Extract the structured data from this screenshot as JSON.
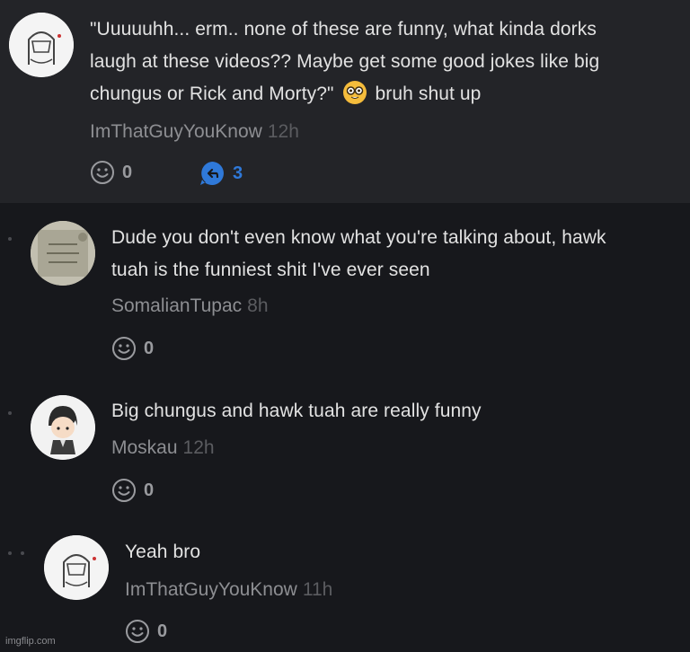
{
  "comments": [
    {
      "text_lines": [
        "\"Uuuuuhh... erm.. none of these are funny, what kinda dorks",
        "laugh at these videos?? Maybe get some good jokes like big"
      ],
      "text_line3_before": "chungus or Rick and Morty?\"",
      "text_line3_after": "bruh shut up",
      "emoji": "nerd-face-emoji",
      "username": "ImThatGuyYouKnow",
      "time": "12h",
      "likes": "0",
      "replies": "3"
    },
    {
      "text_lines": [
        "Dude you don't even know what you're talking about, hawk",
        "tuah is the funniest shit I've ever seen"
      ],
      "username": "SomalianTupac",
      "time": "8h",
      "likes": "0"
    },
    {
      "text_lines": [
        "Big chungus and hawk tuah are really funny"
      ],
      "username": "Moskau",
      "time": "12h",
      "likes": "0"
    },
    {
      "text_lines": [
        "Yeah bro"
      ],
      "username": "ImThatGuyYouKnow",
      "time": "11h",
      "likes": "0"
    }
  ],
  "watermark": "imgflip.com",
  "colors": {
    "background": "#17181c",
    "highlight": "#232428",
    "accent": "#2f79d9"
  }
}
